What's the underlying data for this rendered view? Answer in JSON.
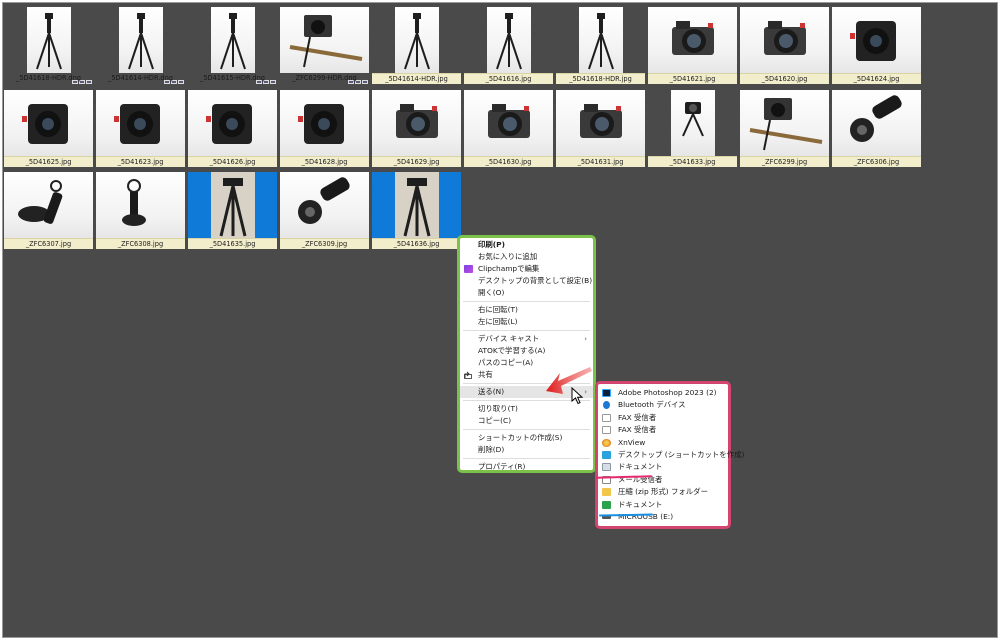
{
  "thumbnails": [
    {
      "name": "_5D41618-HDR.dng",
      "kind": "dng",
      "orient": "portrait",
      "subject": "tripod",
      "selected": false
    },
    {
      "name": "_5D41614-HDR.dng",
      "kind": "dng",
      "orient": "portrait",
      "subject": "tripod",
      "selected": false
    },
    {
      "name": "_5D41615-HDR.dng",
      "kind": "dng",
      "orient": "portrait",
      "subject": "tripod",
      "selected": false
    },
    {
      "name": "_ZFC6299-HDR.dng",
      "kind": "dng",
      "orient": "landscape",
      "subject": "camera-rail",
      "selected": false
    },
    {
      "name": "_5D41614-HDR.jpg",
      "kind": "jpg",
      "orient": "portrait",
      "subject": "tripod",
      "selected": false
    },
    {
      "name": "_5D41616.jpg",
      "kind": "jpg",
      "orient": "portrait",
      "subject": "tripod",
      "selected": false
    },
    {
      "name": "_5D41618-HDR.jpg",
      "kind": "jpg",
      "orient": "portrait",
      "subject": "tripod",
      "selected": false
    },
    {
      "name": "_5D41621.jpg",
      "kind": "jpg",
      "orient": "landscape",
      "subject": "camera",
      "selected": false
    },
    {
      "name": "_5D41620.jpg",
      "kind": "jpg",
      "orient": "landscape",
      "subject": "camera",
      "selected": false
    },
    {
      "name": "_5D41624.jpg",
      "kind": "jpg",
      "orient": "landscape",
      "subject": "camera-filter",
      "selected": false
    },
    {
      "name": "_5D41625.jpg",
      "kind": "jpg",
      "orient": "landscape",
      "subject": "camera-filter",
      "selected": false
    },
    {
      "name": "_5D41623.jpg",
      "kind": "jpg",
      "orient": "landscape",
      "subject": "camera-filter",
      "selected": false
    },
    {
      "name": "_5D41626.jpg",
      "kind": "jpg",
      "orient": "landscape",
      "subject": "camera-filter",
      "selected": false
    },
    {
      "name": "_5D41628.jpg",
      "kind": "jpg",
      "orient": "landscape",
      "subject": "camera-filter",
      "selected": false
    },
    {
      "name": "_5D41629.jpg",
      "kind": "jpg",
      "orient": "landscape",
      "subject": "camera",
      "selected": false
    },
    {
      "name": "_5D41630.jpg",
      "kind": "jpg",
      "orient": "landscape",
      "subject": "camera",
      "selected": false
    },
    {
      "name": "_5D41631.jpg",
      "kind": "jpg",
      "orient": "landscape",
      "subject": "camera",
      "selected": false
    },
    {
      "name": "_5D41633.jpg",
      "kind": "jpg",
      "orient": "portrait",
      "subject": "mini-tripod",
      "selected": false
    },
    {
      "name": "_ZFC6299.jpg",
      "kind": "jpg",
      "orient": "landscape",
      "subject": "camera-rail",
      "selected": false
    },
    {
      "name": "_ZFC6306.jpg",
      "kind": "jpg",
      "orient": "landscape",
      "subject": "grip",
      "selected": false
    },
    {
      "name": "_ZFC6307.jpg",
      "kind": "jpg",
      "orient": "landscape",
      "subject": "mount",
      "selected": false
    },
    {
      "name": "_ZFC6308.jpg",
      "kind": "jpg",
      "orient": "landscape",
      "subject": "clamp",
      "selected": false
    },
    {
      "name": "_5D41635.jpg",
      "kind": "jpg",
      "orient": "portrait",
      "subject": "tripod-legs",
      "selected": true
    },
    {
      "name": "_ZFC6309.jpg",
      "kind": "jpg",
      "orient": "landscape",
      "subject": "grip",
      "selected": false
    },
    {
      "name": "_5D41636.jpg",
      "kind": "jpg",
      "orient": "portrait",
      "subject": "tripod-legs",
      "selected": true
    }
  ],
  "context_menu": {
    "items": [
      {
        "label": "印刷(P)",
        "bold": true,
        "icon": "",
        "submenu": false,
        "highlight": false
      },
      {
        "label": "お気に入りに追加",
        "bold": false,
        "icon": "",
        "submenu": false,
        "highlight": false
      },
      {
        "label": "Clipchampで編集",
        "bold": false,
        "icon": "clipchamp-icon",
        "submenu": false,
        "highlight": false
      },
      {
        "label": "デスクトップの背景として設定(B)",
        "bold": false,
        "icon": "",
        "submenu": false,
        "highlight": false
      },
      {
        "label": "開く(O)",
        "bold": false,
        "icon": "",
        "submenu": false,
        "highlight": false
      },
      {
        "sep": true
      },
      {
        "label": "右に回転(T)",
        "bold": false,
        "icon": "",
        "submenu": false,
        "highlight": false
      },
      {
        "label": "左に回転(L)",
        "bold": false,
        "icon": "",
        "submenu": false,
        "highlight": false
      },
      {
        "sep": true
      },
      {
        "label": "デバイス キャスト",
        "bold": false,
        "icon": "",
        "submenu": true,
        "highlight": false
      },
      {
        "label": "ATOKで学習する(A)",
        "bold": false,
        "icon": "",
        "submenu": false,
        "highlight": false
      },
      {
        "label": "パスのコピー(A)",
        "bold": false,
        "icon": "",
        "submenu": false,
        "highlight": false
      },
      {
        "label": "共有",
        "bold": false,
        "icon": "share-icon",
        "submenu": false,
        "highlight": false
      },
      {
        "sep": true
      },
      {
        "label": "送る(N)",
        "bold": false,
        "icon": "",
        "submenu": true,
        "highlight": true
      },
      {
        "sep": true
      },
      {
        "label": "切り取り(T)",
        "bold": false,
        "icon": "",
        "submenu": false,
        "highlight": false
      },
      {
        "label": "コピー(C)",
        "bold": false,
        "icon": "",
        "submenu": false,
        "highlight": false
      },
      {
        "sep": true
      },
      {
        "label": "ショートカットの作成(S)",
        "bold": false,
        "icon": "",
        "submenu": false,
        "highlight": false
      },
      {
        "label": "削除(D)",
        "bold": false,
        "icon": "",
        "submenu": false,
        "highlight": false
      },
      {
        "sep": true
      },
      {
        "label": "プロパティ(R)",
        "bold": false,
        "icon": "",
        "submenu": false,
        "highlight": false
      }
    ]
  },
  "sendto_menu": {
    "items": [
      {
        "label": "Adobe Photoshop 2023 (2)",
        "icon": "photoshop-icon"
      },
      {
        "label": "Bluetooth デバイス",
        "icon": "bluetooth-icon"
      },
      {
        "label": "FAX 受信者",
        "icon": "document-icon"
      },
      {
        "label": "FAX 受信者",
        "icon": "document-icon"
      },
      {
        "label": "XnView",
        "icon": "xnview-icon"
      },
      {
        "label": "デスクトップ (ショートカットを作成)",
        "icon": "desktop-icon"
      },
      {
        "label": "ドキュメント",
        "icon": "documents-folder-icon"
      },
      {
        "label": "メール受信者",
        "icon": "mail-icon"
      },
      {
        "label": "圧縮 (zip 形式) フォルダー",
        "icon": "zip-folder-icon"
      },
      {
        "label": "ドキュメント",
        "icon": "green-arrow-icon"
      },
      {
        "label": "MICROUSB (E:)",
        "icon": "drive-icon"
      }
    ]
  },
  "colors": {
    "background": "#4a4a4a",
    "selection": "#0f7ad8",
    "context_menu_border": "#7cc24a",
    "sendto_menu_border": "#d2456e",
    "annotation_pink": "#e6286e",
    "annotation_blue": "#1a8fe0",
    "arrow_red": "#e01818"
  }
}
